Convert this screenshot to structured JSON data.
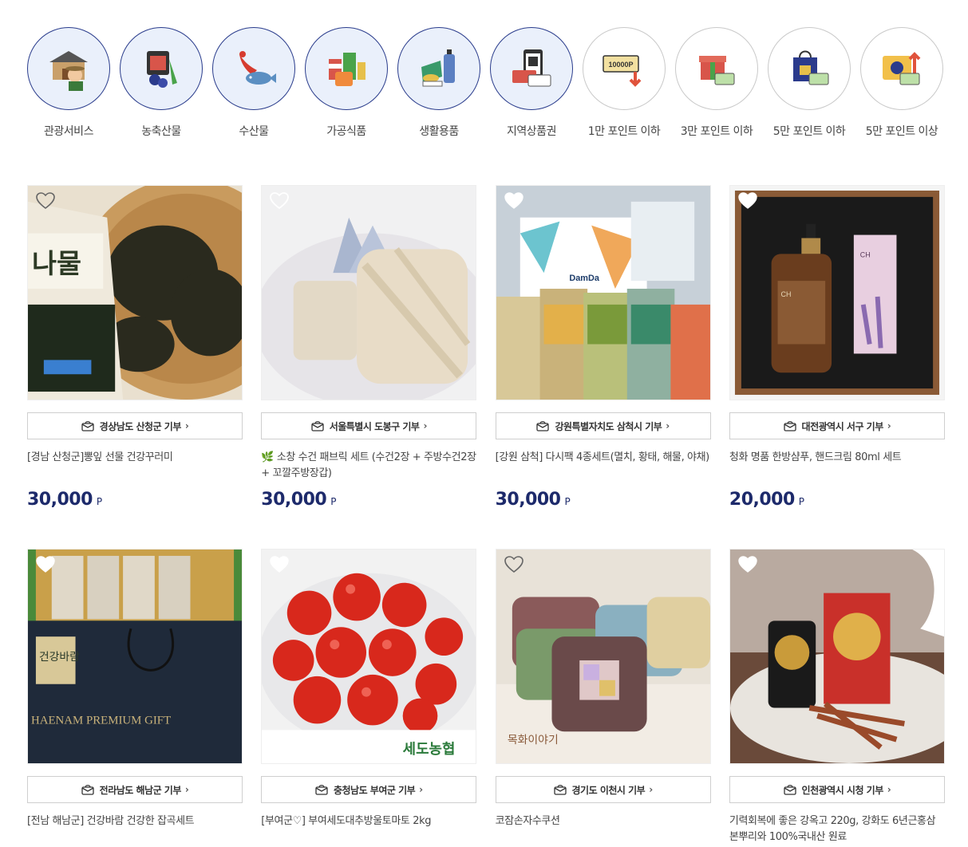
{
  "categories": [
    {
      "label": "관광서비스",
      "icon": "tourism-icon",
      "selected": true
    },
    {
      "label": "농축산물",
      "icon": "agriculture-icon",
      "selected": true
    },
    {
      "label": "수산물",
      "icon": "seafood-icon",
      "selected": true
    },
    {
      "label": "가공식품",
      "icon": "processed-food-icon",
      "selected": true
    },
    {
      "label": "생활용품",
      "icon": "household-icon",
      "selected": true
    },
    {
      "label": "지역상품권",
      "icon": "voucher-icon",
      "selected": true
    },
    {
      "label": "1만 포인트 이하",
      "icon": "points-10000-icon",
      "selected": false
    },
    {
      "label": "3만 포인트 이하",
      "icon": "points-30000-icon",
      "selected": false
    },
    {
      "label": "5만 포인트 이하",
      "icon": "points-50000-icon",
      "selected": false
    },
    {
      "label": "5만 포인트 이상",
      "icon": "points-over-50000-icon",
      "selected": false
    }
  ],
  "point_badge_text": "10000P",
  "products": [
    {
      "donor": "경상남도 산청군 기부",
      "name": "[경남 산청군]뽕잎 선물 건강꾸러미",
      "price": "30,000",
      "unit": "P",
      "image_text": "나물"
    },
    {
      "donor": "서울특별시 도봉구 기부",
      "name_prefix": "🌿",
      "name": "소창 수건 패브릭 세트 (수건2장 + 주방수건2장 + 꼬깔주방장갑)",
      "price": "30,000",
      "unit": "P"
    },
    {
      "donor": "강원특별자치도 삼척시 기부",
      "name": "[강원 삼척] 다시팩 4종세트(멸치, 황태, 해물, 야채)",
      "price": "30,000",
      "unit": "P",
      "image_text": "DamDa"
    },
    {
      "donor": "대전광역시 서구 기부",
      "name": "청화 명품 한방샴푸, 핸드크림 80ml 세트",
      "price": "20,000",
      "unit": "P",
      "image_text": "CH"
    },
    {
      "donor": "전라남도 해남군 기부",
      "name": "[전남 해남군] 건강바람 건강한 잡곡세트",
      "image_text": "HAENAM PREMIUM GIFT",
      "image_text_2": "건강바람"
    },
    {
      "donor": "충청남도 부여군 기부",
      "name": "[부여군♡] 부여세도대추방울토마토 2kg",
      "image_text": "세도농협"
    },
    {
      "donor": "경기도 이천시 기부",
      "name": "코잠손자수쿠션",
      "image_text": "목화이야기"
    },
    {
      "donor": "인천광역시 시청 기부",
      "name": "기력회복에 좋은 강옥고 220g, 강화도 6년근홍삼 본뿌리와 100%국내산 원료"
    }
  ],
  "colors": {
    "accent_navy": "#1d2a6b",
    "category_border": "#2a3c8c",
    "category_bg": "#eaf0fb"
  }
}
